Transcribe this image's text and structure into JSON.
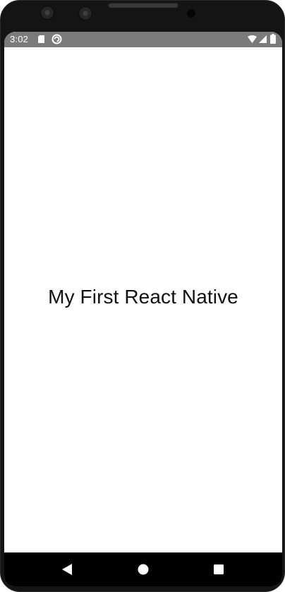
{
  "statusbar": {
    "time": "3:02",
    "icons": [
      "sd-card-icon",
      "sync-icon",
      "wifi-icon",
      "signal-icon",
      "battery-icon"
    ]
  },
  "main": {
    "text": "My First React Native"
  },
  "navbar": {
    "buttons": [
      "back-icon",
      "home-icon",
      "recents-icon"
    ]
  },
  "colors": {
    "statusbar_bg": "#7b7b7b",
    "screen_bg": "#ffffff",
    "navbar_bg": "#000000",
    "text": "#111111"
  }
}
